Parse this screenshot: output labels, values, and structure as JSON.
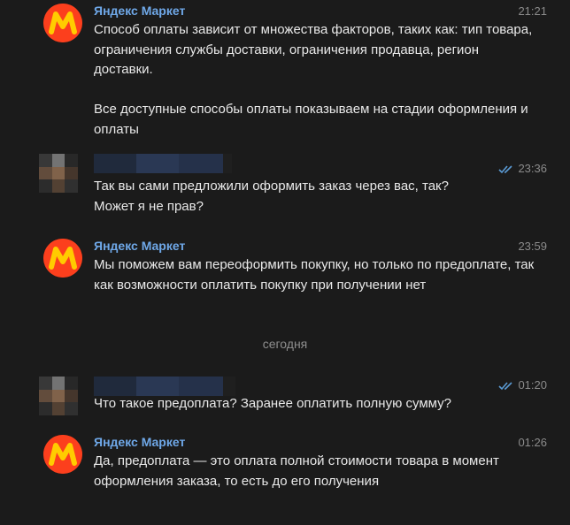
{
  "messages": [
    {
      "sender": "Яндекс Маркет",
      "time": "21:21",
      "text": "Способ оплаты зависит от множества факторов, таких как: тип товара, ограничения службы доставки, ограничения продавца, регион доставки.\n\nВсе доступные способы оплаты показываем на стадии оформления и оплаты",
      "outgoing": false
    },
    {
      "sender": "",
      "time": "23:36",
      "text": "Так вы сами предложили оформить заказ через вас, так?\nМожет я не прав?",
      "outgoing": true,
      "read": true
    },
    {
      "sender": "Яндекс Маркет",
      "time": "23:59",
      "text": "Мы поможем вам переоформить покупку, но только по предоплате, так как возможности оплатить покупку при получении нет",
      "outgoing": false
    },
    {
      "sender": "",
      "time": "01:20",
      "text": "Что такое предоплата? Заранее оплатить полную сумму?",
      "outgoing": true,
      "read": true
    },
    {
      "sender": "Яндекс Маркет",
      "time": "01:26",
      "text": "Да, предоплата — это оплата полной стоимости товара в момент оформления заказа, то есть до его получения",
      "outgoing": false
    }
  ],
  "date_separator": "сегодня",
  "colors": {
    "background": "#1b1b1b",
    "sender_name": "#6fa8e8",
    "timestamp": "#8b8b8b",
    "read_checks": "#5b9bd5",
    "avatar_brand": "#fc3f1d",
    "avatar_letter": "#ffcc00"
  },
  "icons": {
    "sender_avatar": "yandex-market-logo",
    "read_status": "double-check-icon",
    "user_avatar": "pixelated-avatar"
  }
}
